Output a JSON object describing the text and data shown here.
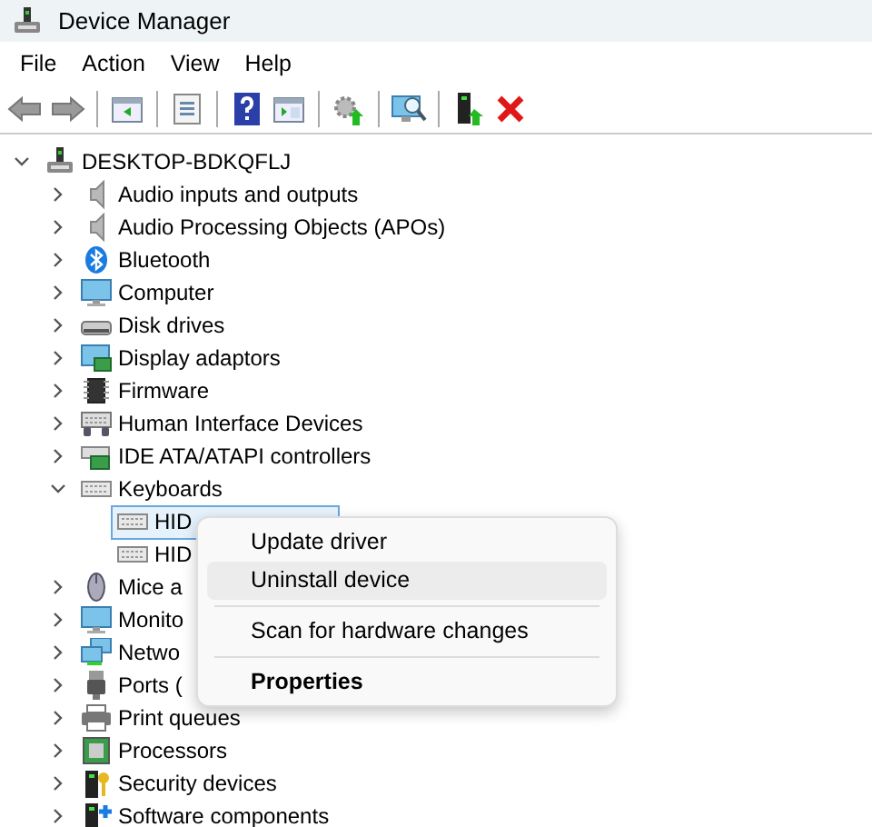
{
  "window": {
    "title": "Device Manager"
  },
  "menu": [
    "File",
    "Action",
    "View",
    "Help"
  ],
  "toolbar": [
    {
      "kind": "back"
    },
    {
      "kind": "forward"
    },
    {
      "kind": "separator"
    },
    {
      "kind": "window"
    },
    {
      "kind": "separator"
    },
    {
      "kind": "list"
    },
    {
      "kind": "separator"
    },
    {
      "kind": "help"
    },
    {
      "kind": "panel"
    },
    {
      "kind": "separator"
    },
    {
      "kind": "update"
    },
    {
      "kind": "separator"
    },
    {
      "kind": "scan"
    },
    {
      "kind": "separator"
    },
    {
      "kind": "enable"
    },
    {
      "kind": "remove"
    }
  ],
  "tree": {
    "label": "DESKTOP-BDKQFLJ",
    "kind": "pc",
    "expanded": true,
    "children": [
      {
        "label": "Audio inputs and outputs",
        "kind": "speaker",
        "expanded": false
      },
      {
        "label": "Audio Processing Objects (APOs)",
        "kind": "speaker",
        "expanded": false
      },
      {
        "label": "Bluetooth",
        "kind": "bluetooth",
        "expanded": false
      },
      {
        "label": "Computer",
        "kind": "monitor",
        "expanded": false
      },
      {
        "label": "Disk drives",
        "kind": "disk",
        "expanded": false
      },
      {
        "label": "Display adaptors",
        "kind": "display",
        "expanded": false
      },
      {
        "label": "Firmware",
        "kind": "chip",
        "expanded": false
      },
      {
        "label": "Human Interface Devices",
        "kind": "hid",
        "expanded": false
      },
      {
        "label": "IDE ATA/ATAPI controllers",
        "kind": "card",
        "expanded": false
      },
      {
        "label": "Keyboards",
        "kind": "keyboard",
        "expanded": true,
        "children": [
          {
            "label": "HID",
            "kind": "keyboard",
            "selected": true
          },
          {
            "label": "HID",
            "kind": "keyboard",
            "selected": false
          }
        ]
      },
      {
        "label": "Mice a",
        "kind": "mouse",
        "expanded": false
      },
      {
        "label": "Monito",
        "kind": "monitor",
        "expanded": false
      },
      {
        "label": "Netwo",
        "kind": "network",
        "expanded": false
      },
      {
        "label": "Ports (",
        "kind": "port",
        "expanded": false
      },
      {
        "label": "Print queues",
        "kind": "printer",
        "expanded": false
      },
      {
        "label": "Processors",
        "kind": "processor",
        "expanded": false
      },
      {
        "label": "Security devices",
        "kind": "security",
        "expanded": false
      },
      {
        "label": "Software components",
        "kind": "software",
        "expanded": false
      }
    ]
  },
  "context_menu": [
    {
      "kind": "item",
      "label": "Update driver",
      "selected": false
    },
    {
      "kind": "item",
      "label": "Uninstall device",
      "selected": true
    },
    {
      "kind": "separator"
    },
    {
      "kind": "item",
      "label": "Scan for hardware changes",
      "selected": false
    },
    {
      "kind": "separator"
    },
    {
      "kind": "default",
      "label": "Properties",
      "selected": false
    }
  ]
}
